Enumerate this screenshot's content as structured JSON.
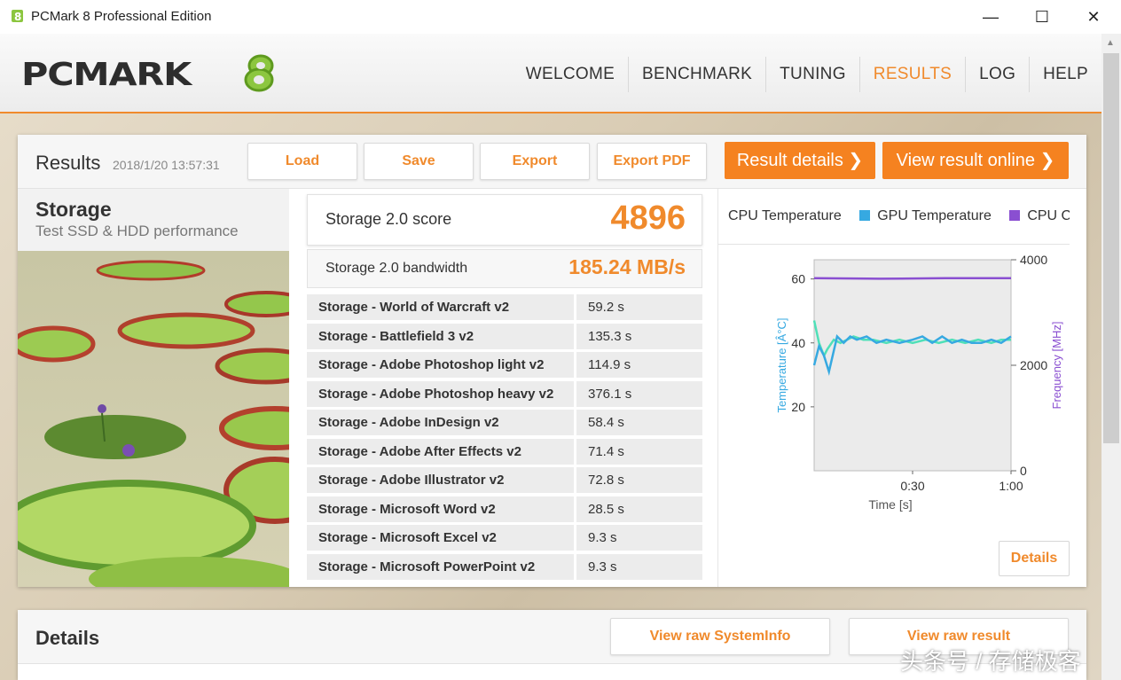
{
  "window": {
    "title": "PCMark 8 Professional Edition",
    "minimize": "—",
    "maximize": "☐",
    "close": "✕"
  },
  "logo": {
    "text": "PCMARK",
    "mark": "8"
  },
  "nav": {
    "items": [
      "WELCOME",
      "BENCHMARK",
      "TUNING",
      "RESULTS",
      "LOG",
      "HELP"
    ],
    "active": "RESULTS"
  },
  "results": {
    "title": "Results",
    "date": "2018/1/20 13:57:31",
    "buttons": {
      "load": "Load",
      "save": "Save",
      "export": "Export",
      "export_pdf": "Export PDF",
      "result_details": "Result details ❯",
      "view_online": "View result online ❯"
    }
  },
  "test": {
    "name": "Storage",
    "description": "Test SSD & HDD performance"
  },
  "score": {
    "label": "Storage 2.0 score",
    "value": "4896",
    "bandwidth_label": "Storage 2.0 bandwidth",
    "bandwidth_value": "185.24 MB/s"
  },
  "subtests": [
    {
      "name": "Storage - World of Warcraft v2",
      "value": "59.2 s"
    },
    {
      "name": "Storage - Battlefield 3 v2",
      "value": "135.3 s"
    },
    {
      "name": "Storage - Adobe Photoshop light v2",
      "value": "114.9 s"
    },
    {
      "name": "Storage - Adobe Photoshop heavy v2",
      "value": "376.1 s"
    },
    {
      "name": "Storage - Adobe InDesign v2",
      "value": "58.4 s"
    },
    {
      "name": "Storage - Adobe After Effects v2",
      "value": "71.4 s"
    },
    {
      "name": "Storage - Adobe Illustrator v2",
      "value": "72.8 s"
    },
    {
      "name": "Storage - Microsoft Word v2",
      "value": "28.5 s"
    },
    {
      "name": "Storage - Microsoft Excel v2",
      "value": "9.3 s"
    },
    {
      "name": "Storage - Microsoft PowerPoint v2",
      "value": "9.3 s"
    }
  ],
  "chart_data": {
    "type": "line",
    "legend": [
      {
        "name": "CPU Temperature",
        "color": "#4fe0b8"
      },
      {
        "name": "GPU Temperature",
        "color": "#36a9e1"
      },
      {
        "name": "CPU Clo",
        "color": "#8a4fd1"
      }
    ],
    "xlabel": "Time [s]",
    "ylabel_left": "Temperature [Â°C]",
    "ylabel_right": "Frequency [MHz]",
    "x_ticks": [
      "0:30",
      "1:00"
    ],
    "y_left_ticks": [
      "60",
      "40",
      "20"
    ],
    "y_right_ticks": [
      "4000",
      "2000",
      "0"
    ],
    "xlim": [
      0,
      60
    ],
    "ylim_left": [
      0,
      66
    ],
    "ylim_right": [
      0,
      4000
    ],
    "series": [
      {
        "name": "CPU Temperature",
        "axis": "left",
        "color": "#4fe0b8",
        "x": [
          0,
          1.5,
          3,
          4,
          6,
          8,
          10,
          12,
          15,
          18,
          22,
          26,
          30,
          34,
          38,
          42,
          46,
          50,
          54,
          57,
          60
        ],
        "y": [
          47,
          40,
          36,
          38,
          41,
          40,
          41,
          42,
          41,
          41,
          40,
          41,
          40,
          41,
          40,
          41,
          40,
          41,
          40,
          41,
          41
        ]
      },
      {
        "name": "GPU Temperature",
        "axis": "left",
        "color": "#36a9e1",
        "x": [
          0,
          1.5,
          3,
          4.5,
          7,
          9,
          11,
          13,
          16,
          19,
          22,
          26,
          30,
          33,
          36,
          39,
          42,
          45,
          48,
          51,
          54,
          57,
          60
        ],
        "y": [
          33,
          39,
          36,
          31,
          42,
          40,
          42,
          41,
          42,
          40,
          41,
          40,
          41,
          42,
          40,
          42,
          40,
          41,
          40,
          40,
          41,
          40,
          42
        ]
      },
      {
        "name": "CPU Clo",
        "axis": "right",
        "color": "#8a4fd1",
        "x": [
          0,
          20,
          40,
          60
        ],
        "y": [
          3650,
          3640,
          3650,
          3650
        ]
      }
    ]
  },
  "details_button": "Details",
  "details": {
    "title": "Details",
    "view_systeminfo": "View raw SystemInfo",
    "view_raw_result": "View raw result"
  },
  "watermark": "头条号 / 存储极客"
}
